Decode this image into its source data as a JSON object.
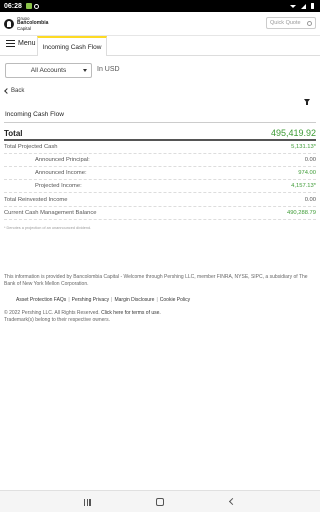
{
  "status_bar": {
    "time": "06:28"
  },
  "header": {
    "logo_line1": "Grupo",
    "logo_line2": "Bancolombia",
    "logo_line3": "Capital",
    "quick_quote_placeholder": "Quick Quote"
  },
  "nav": {
    "menu_label": "Menu",
    "active_tab": "Incoming Cash Flow"
  },
  "filters": {
    "account_selected": "All Accounts",
    "currency_label": "In USD"
  },
  "back_label": "Back",
  "section_title": "Incoming Cash Flow",
  "total": {
    "label": "Total",
    "value": "495,419.92"
  },
  "rows": [
    {
      "label": "Total Projected Cash",
      "value": "5,131.13*"
    },
    {
      "label": "Announced Principal:",
      "value": "0.00"
    },
    {
      "label": "Announced Income:",
      "value": "974.00"
    },
    {
      "label": "Projected Income:",
      "value": "4,157.13*"
    },
    {
      "label": "Total Reinvested Income",
      "value": "0.00"
    },
    {
      "label": "Current Cash Management Balance",
      "value": "490,288.79"
    }
  ],
  "footnote": "* Denotes a projection of an unannounced dividend.",
  "disclaimer": "This information is provided by Bancolombia Capital - Welcome through Pershing LLC, member FINRA, NYSE, SIPC, a subsidiary of The Bank of New York Mellon Corporation.",
  "links": [
    "Asset Protection FAQs",
    "Pershing Privacy",
    "Margin Disclosure",
    "Cookie Policy"
  ],
  "copyright": {
    "text": "© 2022 Pershing LLC. All Rights Reserved.",
    "terms_link": "Click here for terms of use.",
    "trademark": "Trademark(s) belong to their respective owners."
  },
  "colors": {
    "accent_yellow": "#fdda24",
    "positive_green": "#3d9b35"
  }
}
